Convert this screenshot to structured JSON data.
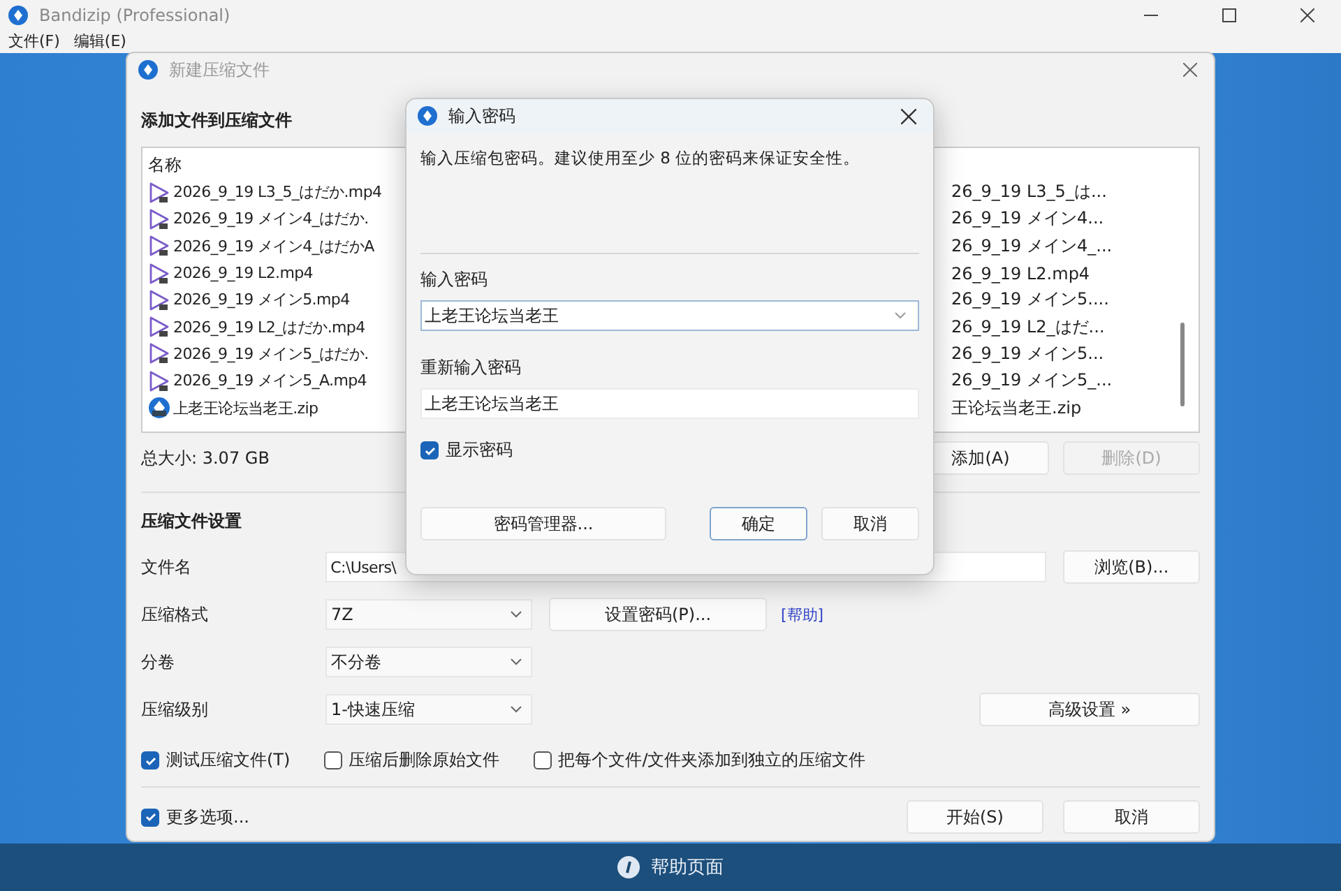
{
  "app_window": {
    "title": "Bandizip (Professional)",
    "menu": [
      "文件(F)",
      "编辑(E)"
    ]
  },
  "help_bar": {
    "label": "帮助页面"
  },
  "new_archive_dialog": {
    "title": "新建压缩文件",
    "files_heading": "添加文件到压缩文件",
    "name_column": "名称",
    "files": [
      {
        "kind": "video",
        "name": "2026_9_19 L3_5_はだか.mp4",
        "column_2": "26_9_19 L3_5_は..."
      },
      {
        "kind": "video",
        "name": "2026_9_19 メイン4_はだか.",
        "column_2": "26_9_19 メイン4..."
      },
      {
        "kind": "video",
        "name": "2026_9_19 メイン4_はだかA",
        "column_2": "26_9_19 メイン4_..."
      },
      {
        "kind": "video",
        "name": "2026_9_19 L2.mp4",
        "column_2": "26_9_19 L2.mp4"
      },
      {
        "kind": "video",
        "name": "2026_9_19 メイン5.mp4",
        "column_2": "26_9_19 メイン5...."
      },
      {
        "kind": "video",
        "name": "2026_9_19 L2_はだか.mp4",
        "column_2": "26_9_19 L2_はだ..."
      },
      {
        "kind": "video",
        "name": "2026_9_19 メイン5_はだか.",
        "column_2": "26_9_19 メイン5..."
      },
      {
        "kind": "video",
        "name": "2026_9_19 メイン5_A.mp4",
        "column_2": "26_9_19 メイン5_..."
      },
      {
        "kind": "archive",
        "name": "上老王论坛当老王.zip",
        "column_2": "王论坛当老王.zip"
      }
    ],
    "total_size": "总大小: 3.07 GB",
    "add_button": {
      "label": "添加(A)",
      "disabled": false
    },
    "delete_button": {
      "label": "删除(D)",
      "disabled": true
    },
    "settings_heading": "压缩文件设置",
    "filename": {
      "label": "文件名",
      "value": "C:\\Users\\",
      "button": "浏览(B)..."
    },
    "format": {
      "label": "压缩格式",
      "value": "7Z",
      "button": "设置密码(P)...",
      "link": "[帮助]"
    },
    "split": {
      "label": "分卷",
      "value": "不分卷"
    },
    "level": {
      "label": "压缩级别",
      "value": "1-快速压缩",
      "button": "高级设置 »"
    },
    "options": [
      {
        "label": "测试压缩文件(T)",
        "checked": true
      },
      {
        "label": "压缩后删除原始文件",
        "checked": false
      },
      {
        "label": "把每个文件/文件夹添加到独立的压缩文件",
        "checked": false
      }
    ],
    "more_options": {
      "label": "更多选项...",
      "checked": true
    },
    "buttons": [
      {
        "label": "开始(S)"
      },
      {
        "label": "取消"
      }
    ]
  },
  "password_dialog": {
    "title": "输入密码",
    "message": "输入压缩包密码。建议使用至少 8 位的密码来保证安全性。",
    "password_label": "输入密码",
    "password_value": "上老王论坛当老王",
    "confirm_label": "重新输入密码",
    "confirm_value": "上老王论坛当老王",
    "show_password": {
      "label": "显示密码",
      "checked": true
    },
    "manager_button": "密码管理器...",
    "buttons": [
      {
        "label": "确定",
        "default": true
      },
      {
        "label": "取消",
        "default": false
      }
    ]
  }
}
